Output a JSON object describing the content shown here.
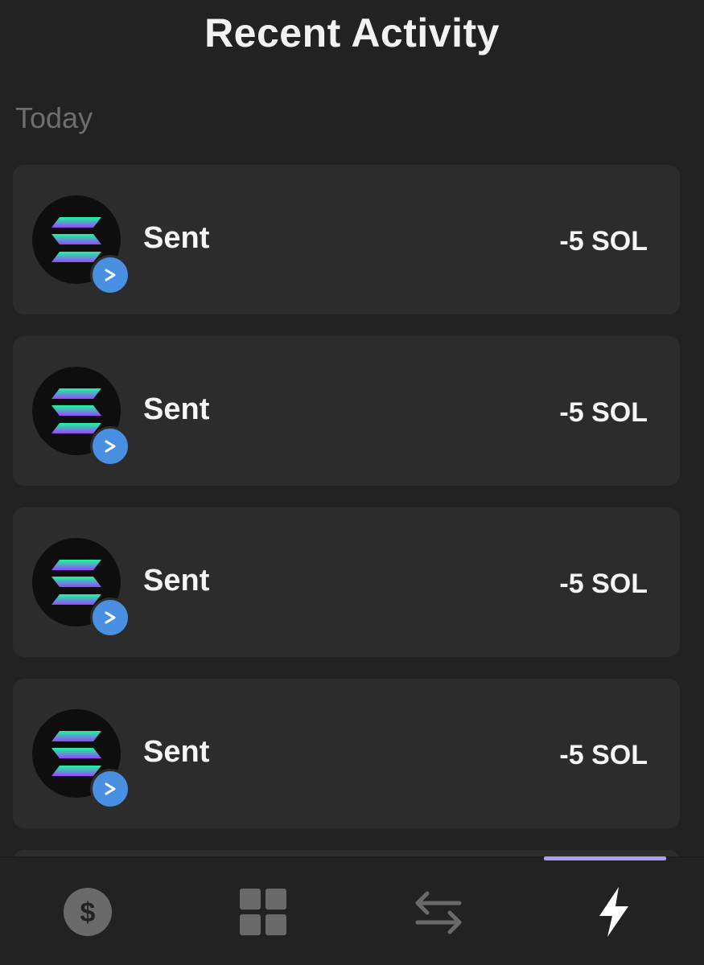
{
  "header": {
    "title": "Recent Activity"
  },
  "section": {
    "label": "Today"
  },
  "activities": [
    {
      "label": "Sent",
      "amount": "-5 SOL",
      "token_icon": "solana-icon",
      "badge_icon": "send-arrow-icon"
    },
    {
      "label": "Sent",
      "amount": "-5 SOL",
      "token_icon": "solana-icon",
      "badge_icon": "send-arrow-icon"
    },
    {
      "label": "Sent",
      "amount": "-5 SOL",
      "token_icon": "solana-icon",
      "badge_icon": "send-arrow-icon"
    },
    {
      "label": "Sent",
      "amount": "-5 SOL",
      "token_icon": "solana-icon",
      "badge_icon": "send-arrow-icon"
    }
  ],
  "bottom_nav": {
    "items": [
      {
        "icon": "dollar-icon",
        "active": false
      },
      {
        "icon": "grid-icon",
        "active": false
      },
      {
        "icon": "swap-icon",
        "active": false
      },
      {
        "icon": "lightning-icon",
        "active": true
      }
    ]
  },
  "colors": {
    "background": "#222222",
    "card": "#2c2c2c",
    "badge": "#4a90e2",
    "active_tab": "#ab9ff2",
    "inactive_icon": "#6a6a6a"
  }
}
